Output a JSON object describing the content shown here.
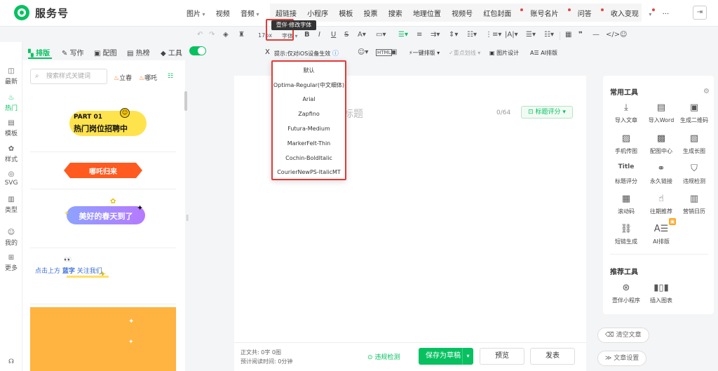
{
  "app": {
    "logo_text": "服务号"
  },
  "topnav": {
    "group1": [
      "图片",
      "视频",
      "音频"
    ],
    "group2": [
      "超链接",
      "小程序",
      "模板",
      "投票",
      "搜索",
      "地理位置",
      "视频号",
      "红包封面",
      "账号名片",
      "问答",
      "收入变现"
    ],
    "more": "···"
  },
  "tooltip": "壹伴·修改字体",
  "toolbar": {
    "font_size": "17px",
    "font_label": "字体",
    "hint": "提示:仅对iOS设备生效",
    "one_key": "一键排版",
    "key_create": "重点划线",
    "image_design": "图片设计",
    "ai_layout": "AI排版"
  },
  "font_dropdown": {
    "options": [
      "默认",
      "Optima-Regular(中文细体)",
      "Arial",
      "Zapfino",
      "Futura-Medium",
      "MarkerFelt-Thin",
      "Cochin-BoldItalic",
      "CourierNewPS-ItalicMT"
    ]
  },
  "plugin_tabs": [
    "排版",
    "写作",
    "配图",
    "热榜",
    "工具"
  ],
  "rail": [
    "最新",
    "热门",
    "模板",
    "样式",
    "SVG",
    "类型",
    "我的",
    "更多"
  ],
  "panel": {
    "search_placeholder": "搜索样式关键词",
    "filters": [
      "立春",
      "哪吒"
    ],
    "cards": [
      {
        "line1": "PART 01",
        "line2": "热门岗位招聘中"
      },
      {
        "text": "哪吒归来"
      },
      {
        "text": "美好的春天到了"
      },
      {
        "text_a": "点击上方",
        "text_b": "蓝字",
        "text_c": "关注我们"
      }
    ]
  },
  "editor": {
    "title_placeholder": "标题",
    "title_count": "0/64",
    "title_score": "标题评分",
    "stat_line1": "正文共: 0字 0图",
    "stat_line2": "预计阅读时间: 0分钟",
    "check": "违规检测",
    "save_draft": "保存为草稿",
    "preview": "预览",
    "publish": "发表"
  },
  "right_panel": {
    "common_title": "常用工具",
    "common_tools": [
      "导入文章",
      "导入Word",
      "生成二维码",
      "手机传图",
      "配图中心",
      "生成长图",
      "标题评分",
      "永久链接",
      "违规检测",
      "滚动码",
      "往期推荐",
      "营销日历",
      "短链生成",
      "AI排版"
    ],
    "recommend_title": "推荐工具",
    "recommend_tools": [
      "壹伴小程序",
      "插入图表"
    ],
    "clear": "清空文章",
    "settings": "文章设置"
  },
  "colors": {
    "brand_green": "#07c160",
    "highlight_red": "#e53935"
  }
}
